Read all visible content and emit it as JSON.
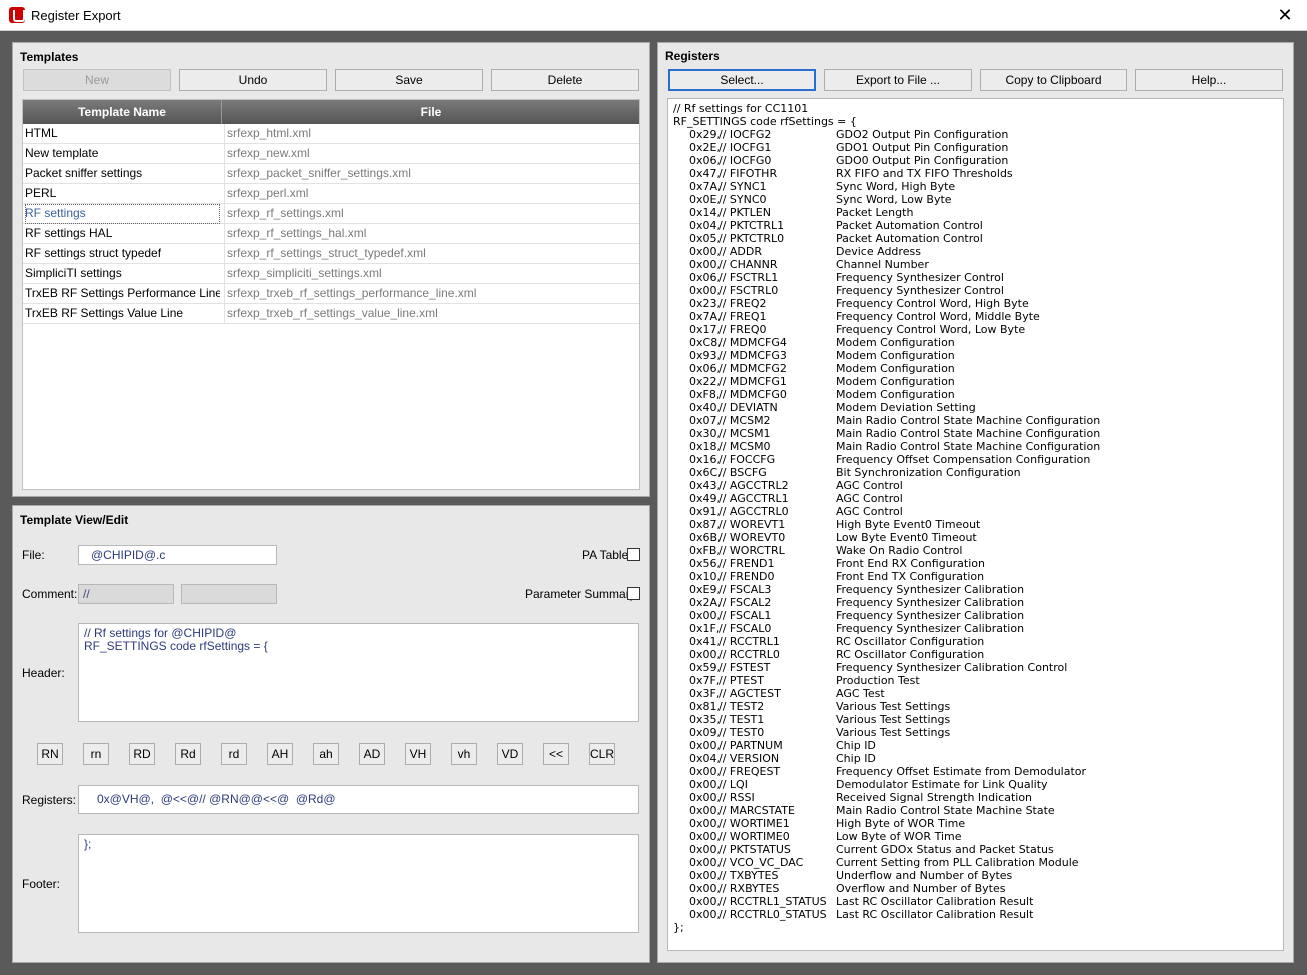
{
  "window": {
    "title": "Register Export",
    "close": "✕"
  },
  "templates": {
    "title": "Templates",
    "buttons": {
      "new": "New",
      "undo": "Undo",
      "save": "Save",
      "delete": "Delete"
    },
    "columns": [
      "Template Name",
      "File"
    ],
    "rows": [
      {
        "name": "HTML",
        "file": "srfexp_html.xml"
      },
      {
        "name": "New template",
        "file": "srfexp_new.xml"
      },
      {
        "name": "Packet sniffer settings",
        "file": "srfexp_packet_sniffer_settings.xml"
      },
      {
        "name": "PERL",
        "file": "srfexp_perl.xml"
      },
      {
        "name": "RF settings",
        "file": "srfexp_rf_settings.xml"
      },
      {
        "name": "RF settings HAL",
        "file": "srfexp_rf_settings_hal.xml"
      },
      {
        "name": "RF settings struct typedef",
        "file": "srfexp_rf_settings_struct_typedef.xml"
      },
      {
        "name": "SimpliciTI settings",
        "file": "srfexp_simpliciti_settings.xml"
      },
      {
        "name": "TrxEB RF Settings Performance Line",
        "file": "srfexp_trxeb_rf_settings_performance_line.xml"
      },
      {
        "name": "TrxEB RF Settings Value Line",
        "file": "srfexp_trxeb_rf_settings_value_line.xml"
      }
    ],
    "selected_row": "RF settings"
  },
  "edit": {
    "title": "Template View/Edit",
    "file_label": "File:",
    "file_value": "@CHIPID@.c",
    "pa_table_label": "PA Table",
    "comment_label": "Comment:",
    "comment_value": "//",
    "comment_value2": "",
    "param_summary_label": "Parameter Summary",
    "header_label": "Header:",
    "header_value": "// Rf settings for @CHIPID@\nRF_SETTINGS code rfSettings = {",
    "tokens": [
      "RN",
      "rn",
      "RD",
      "Rd",
      "rd",
      "AH",
      "ah",
      "AD",
      "VH",
      "vh",
      "VD",
      "<<",
      "CLR"
    ],
    "registers_label": "Registers:",
    "registers_value": "0x@VH@,  @<<@// @RN@@<<@  @Rd@",
    "footer_label": "Footer:",
    "footer_value": "};"
  },
  "registers": {
    "title": "Registers",
    "buttons": {
      "select": "Select...",
      "export": "Export to File ...",
      "copy": "Copy to Clipboard",
      "help": "Help..."
    },
    "line1": "// Rf settings for CC1101",
    "line2": "RF_SETTINGS code rfSettings = {",
    "entries": [
      [
        "0x29,",
        "// IOCFG2",
        "GDO2 Output Pin Configuration"
      ],
      [
        "0x2E,",
        "// IOCFG1",
        "GDO1 Output Pin Configuration"
      ],
      [
        "0x06,",
        "// IOCFG0",
        "GDO0 Output Pin Configuration"
      ],
      [
        "0x47,",
        "// FIFOTHR",
        "RX FIFO and TX FIFO Thresholds"
      ],
      [
        "0x7A,",
        "// SYNC1",
        "Sync Word, High Byte"
      ],
      [
        "0x0E,",
        "// SYNC0",
        "Sync Word, Low Byte"
      ],
      [
        "0x14,",
        "// PKTLEN",
        "Packet Length"
      ],
      [
        "0x04,",
        "// PKTCTRL1",
        "Packet Automation Control"
      ],
      [
        "0x05,",
        "// PKTCTRL0",
        "Packet Automation Control"
      ],
      [
        "0x00,",
        "// ADDR",
        "Device Address"
      ],
      [
        "0x00,",
        "// CHANNR",
        "Channel Number"
      ],
      [
        "0x06,",
        "// FSCTRL1",
        "Frequency Synthesizer Control"
      ],
      [
        "0x00,",
        "// FSCTRL0",
        "Frequency Synthesizer Control"
      ],
      [
        "0x23,",
        "// FREQ2",
        "Frequency Control Word, High Byte"
      ],
      [
        "0x7A,",
        "// FREQ1",
        "Frequency Control Word, Middle Byte"
      ],
      [
        "0x17,",
        "// FREQ0",
        "Frequency Control Word, Low Byte"
      ],
      [
        "0xC8,",
        "// MDMCFG4",
        "Modem Configuration"
      ],
      [
        "0x93,",
        "// MDMCFG3",
        "Modem Configuration"
      ],
      [
        "0x06,",
        "// MDMCFG2",
        "Modem Configuration"
      ],
      [
        "0x22,",
        "// MDMCFG1",
        "Modem Configuration"
      ],
      [
        "0xF8,",
        "// MDMCFG0",
        "Modem Configuration"
      ],
      [
        "0x40,",
        "// DEVIATN",
        "Modem Deviation Setting"
      ],
      [
        "0x07,",
        "// MCSM2",
        "Main Radio Control State Machine Configuration"
      ],
      [
        "0x30,",
        "// MCSM1",
        "Main Radio Control State Machine Configuration"
      ],
      [
        "0x18,",
        "// MCSM0",
        "Main Radio Control State Machine Configuration"
      ],
      [
        "0x16,",
        "// FOCCFG",
        "Frequency Offset Compensation Configuration"
      ],
      [
        "0x6C,",
        "// BSCFG",
        "Bit Synchronization Configuration"
      ],
      [
        "0x43,",
        "// AGCCTRL2",
        "AGC Control"
      ],
      [
        "0x49,",
        "// AGCCTRL1",
        "AGC Control"
      ],
      [
        "0x91,",
        "// AGCCTRL0",
        "AGC Control"
      ],
      [
        "0x87,",
        "// WOREVT1",
        "High Byte Event0 Timeout"
      ],
      [
        "0x6B,",
        "// WOREVT0",
        "Low Byte Event0 Timeout"
      ],
      [
        "0xFB,",
        "// WORCTRL",
        "Wake On Radio Control"
      ],
      [
        "0x56,",
        "// FREND1",
        "Front End RX Configuration"
      ],
      [
        "0x10,",
        "// FREND0",
        "Front End TX Configuration"
      ],
      [
        "0xE9,",
        "// FSCAL3",
        "Frequency Synthesizer Calibration"
      ],
      [
        "0x2A,",
        "// FSCAL2",
        "Frequency Synthesizer Calibration"
      ],
      [
        "0x00,",
        "// FSCAL1",
        "Frequency Synthesizer Calibration"
      ],
      [
        "0x1F,",
        "// FSCAL0",
        "Frequency Synthesizer Calibration"
      ],
      [
        "0x41,",
        "// RCCTRL1",
        "RC Oscillator Configuration"
      ],
      [
        "0x00,",
        "// RCCTRL0",
        "RC Oscillator Configuration"
      ],
      [
        "0x59,",
        "// FSTEST",
        "Frequency Synthesizer Calibration Control"
      ],
      [
        "0x7F,",
        "// PTEST",
        "Production Test"
      ],
      [
        "0x3F,",
        "// AGCTEST",
        "AGC Test"
      ],
      [
        "0x81,",
        "// TEST2",
        "Various Test Settings"
      ],
      [
        "0x35,",
        "// TEST1",
        "Various Test Settings"
      ],
      [
        "0x09,",
        "// TEST0",
        "Various Test Settings"
      ],
      [
        "0x00,",
        "// PARTNUM",
        "Chip ID"
      ],
      [
        "0x04,",
        "// VERSION",
        "Chip ID"
      ],
      [
        "0x00,",
        "// FREQEST",
        "Frequency Offset Estimate from Demodulator"
      ],
      [
        "0x00,",
        "// LQI",
        "Demodulator Estimate for Link Quality"
      ],
      [
        "0x00,",
        "// RSSI",
        "Received Signal Strength Indication"
      ],
      [
        "0x00,",
        "// MARCSTATE",
        "Main Radio Control State Machine State"
      ],
      [
        "0x00,",
        "// WORTIME1",
        "High Byte of WOR Time"
      ],
      [
        "0x00,",
        "// WORTIME0",
        "Low Byte of WOR Time"
      ],
      [
        "0x00,",
        "// PKTSTATUS",
        "Current GDOx Status and Packet Status"
      ],
      [
        "0x00,",
        "// VCO_VC_DAC",
        "Current Setting from PLL Calibration Module"
      ],
      [
        "0x00,",
        "// TXBYTES",
        "Underflow and Number of Bytes"
      ],
      [
        "0x00,",
        "// RXBYTES",
        "Overflow and Number of Bytes"
      ],
      [
        "0x00,",
        "// RCCTRL1_STATUS",
        "Last RC Oscillator Calibration Result"
      ],
      [
        "0x00,",
        "// RCCTRL0_STATUS",
        "Last RC Oscillator Calibration Result"
      ]
    ],
    "closing": "};"
  }
}
